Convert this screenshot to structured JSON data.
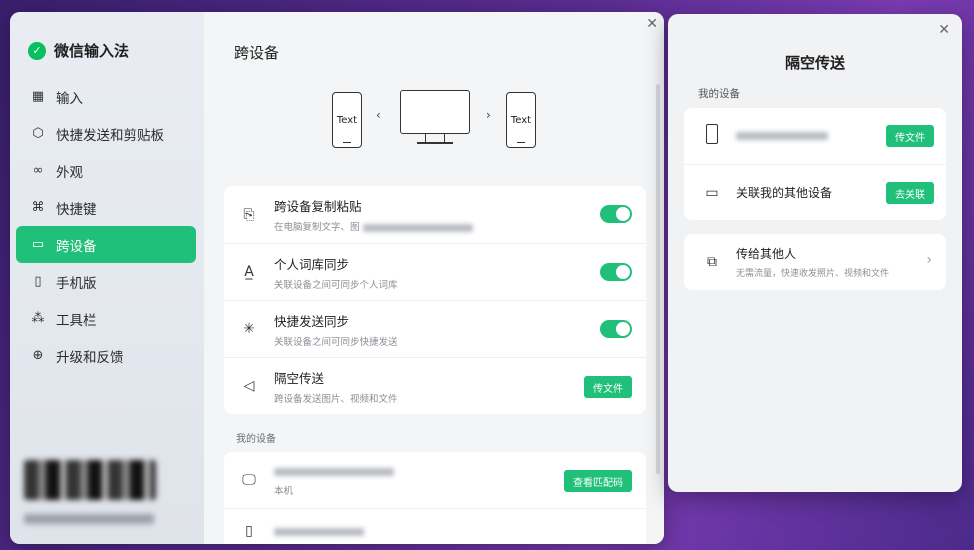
{
  "sidebar": {
    "app_name": "微信输入法",
    "items": [
      {
        "label": "输入"
      },
      {
        "label": "快捷发送和剪贴板"
      },
      {
        "label": "外观"
      },
      {
        "label": "快捷键"
      },
      {
        "label": "跨设备"
      },
      {
        "label": "手机版"
      },
      {
        "label": "工具栏"
      },
      {
        "label": "升级和反馈"
      }
    ]
  },
  "content": {
    "title": "跨设备",
    "illustration": {
      "left_text": "Text",
      "right_text": "Text"
    },
    "settings": [
      {
        "title": "跨设备复制粘贴",
        "desc": "在电脑复制文字、图"
      },
      {
        "title": "个人词库同步",
        "desc": "关联设备之间可同步个人词库"
      },
      {
        "title": "快捷发送同步",
        "desc": "关联设备之间可同步快捷发送"
      },
      {
        "title": "隔空传送",
        "desc": "跨设备发送图片、视频和文件",
        "button": "传文件"
      }
    ],
    "my_devices_label": "我的设备",
    "devices": [
      {
        "name": "本机",
        "button": "查看匹配码"
      }
    ]
  },
  "airdrop": {
    "title": "隔空传送",
    "my_devices_label": "我的设备",
    "device_button": "传文件",
    "link_other": "关联我的其他设备",
    "link_button": "去关联",
    "send_others_title": "传给其他人",
    "send_others_desc": "无需流量，快速收发照片、视频和文件"
  },
  "colors": {
    "accent": "#21c07a"
  },
  "icons": [
    "keyboard-icon",
    "cube-icon",
    "appearance-icon",
    "command-icon",
    "devices-icon",
    "phone-icon",
    "toolbar-icon",
    "upgrade-icon",
    "clipboard-icon",
    "dictionary-icon",
    "sync-icon",
    "send-icon",
    "monitor-icon",
    "close-icon",
    "chevron-right-icon"
  ]
}
